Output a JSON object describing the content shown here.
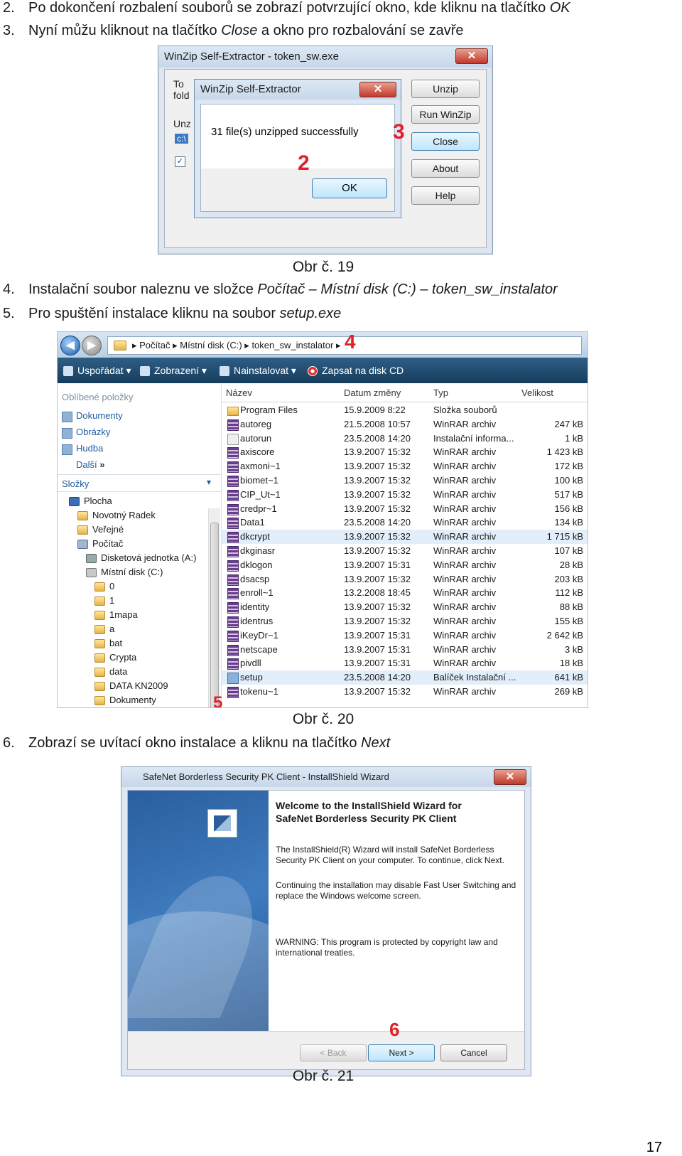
{
  "steps": [
    {
      "num": "2.",
      "pre": "Po dokončení rozbalení souborů se zobrazí potvrzující okno, kde kliknu na tlačítko ",
      "em": "OK",
      "post": ""
    },
    {
      "num": "3.",
      "pre": "Nyní můžu kliknout na tlačítko ",
      "em": "Close",
      "post": " a okno pro rozbalování se zavře"
    },
    {
      "num": "4.",
      "pre": "Instalační soubor naleznu ve složce ",
      "em": "Počítač – Místní disk (C:) – token_sw_instalator",
      "post": ""
    },
    {
      "num": "5.",
      "pre": "Pro spuštění instalace kliknu na soubor ",
      "em": "setup.exe",
      "post": ""
    },
    {
      "num": "6.",
      "pre": "Zobrazí se uvítací okno instalace a kliknu na tlačítko ",
      "em": "Next",
      "post": ""
    }
  ],
  "captions": [
    "Obr č. 19",
    "Obr č. 20",
    "Obr č. 21"
  ],
  "page_number": "17",
  "marks": [
    "2",
    "3",
    "4",
    "5",
    "6"
  ],
  "fig19": {
    "window_title": "WinZip Self-Extractor - token_sw.exe",
    "close_glyph": "✕",
    "ghost_labels": [
      "To",
      "fold",
      "Unz",
      "c:\\"
    ],
    "buttons": [
      "Unzip",
      "Run WinZip",
      "Close",
      "About",
      "Help"
    ],
    "dialog_title": "WinZip Self-Extractor",
    "dialog_message": "31 file(s) unzipped successfully",
    "ok_label": "OK"
  },
  "fig20": {
    "breadcrumb": [
      "Počítač",
      "Místní disk (C:)",
      "token_sw_instalator"
    ],
    "toolbar": [
      "Uspořádat",
      "Zobrazení",
      "Nainstalovat",
      "Zapsat na disk CD"
    ],
    "favorites_header": "Oblíbené položky",
    "favorites": [
      "Dokumenty",
      "Obrázky",
      "Hudba",
      "Další"
    ],
    "more_glyph": "»",
    "folders_header": "Složky",
    "tree": [
      "Plocha",
      "Novotný Radek",
      "Veřejné",
      "Počítač",
      "Disketová jednotka (A:)",
      "Místní disk (C:)",
      "0",
      "1",
      "1mapa",
      "a",
      "bat",
      "Crypta",
      "data",
      "DATA KN2009",
      "Dokumenty"
    ],
    "columns": [
      "Název",
      "Datum změny",
      "Typ",
      "Velikost"
    ],
    "files": [
      {
        "name": "Program Files",
        "date": "15.9.2009 8:22",
        "type": "Složka souborů",
        "size": "",
        "icon": "dir"
      },
      {
        "name": "autoreg",
        "date": "21.5.2008 10:57",
        "type": "WinRAR archiv",
        "size": "247 kB",
        "icon": "rar"
      },
      {
        "name": "autorun",
        "date": "23.5.2008 14:20",
        "type": "Instalační informa...",
        "size": "1 kB",
        "icon": "inf"
      },
      {
        "name": "axiscore",
        "date": "13.9.2007 15:32",
        "type": "WinRAR archiv",
        "size": "1 423 kB",
        "icon": "rar"
      },
      {
        "name": "axmoni~1",
        "date": "13.9.2007 15:32",
        "type": "WinRAR archiv",
        "size": "172 kB",
        "icon": "rar"
      },
      {
        "name": "biomet~1",
        "date": "13.9.2007 15:32",
        "type": "WinRAR archiv",
        "size": "100 kB",
        "icon": "rar"
      },
      {
        "name": "CIP_Ut~1",
        "date": "13.9.2007 15:32",
        "type": "WinRAR archiv",
        "size": "517 kB",
        "icon": "rar"
      },
      {
        "name": "credpr~1",
        "date": "13.9.2007 15:32",
        "type": "WinRAR archiv",
        "size": "156 kB",
        "icon": "rar"
      },
      {
        "name": "Data1",
        "date": "23.5.2008 14:20",
        "type": "WinRAR archiv",
        "size": "134 kB",
        "icon": "rar"
      },
      {
        "name": "dkcrypt",
        "date": "13.9.2007 15:32",
        "type": "WinRAR archiv",
        "size": "1 715 kB",
        "icon": "rar",
        "sel": true
      },
      {
        "name": "dkginasr",
        "date": "13.9.2007 15:32",
        "type": "WinRAR archiv",
        "size": "107 kB",
        "icon": "rar"
      },
      {
        "name": "dklogon",
        "date": "13.9.2007 15:31",
        "type": "WinRAR archiv",
        "size": "28 kB",
        "icon": "rar"
      },
      {
        "name": "dsacsp",
        "date": "13.9.2007 15:32",
        "type": "WinRAR archiv",
        "size": "203 kB",
        "icon": "rar"
      },
      {
        "name": "enroll~1",
        "date": "13.2.2008 18:45",
        "type": "WinRAR archiv",
        "size": "112 kB",
        "icon": "rar"
      },
      {
        "name": "identity",
        "date": "13.9.2007 15:32",
        "type": "WinRAR archiv",
        "size": "88 kB",
        "icon": "rar"
      },
      {
        "name": "identrus",
        "date": "13.9.2007 15:32",
        "type": "WinRAR archiv",
        "size": "155 kB",
        "icon": "rar"
      },
      {
        "name": "iKeyDr~1",
        "date": "13.9.2007 15:31",
        "type": "WinRAR archiv",
        "size": "2 642 kB",
        "icon": "rar"
      },
      {
        "name": "netscape",
        "date": "13.9.2007 15:31",
        "type": "WinRAR archiv",
        "size": "3 kB",
        "icon": "rar"
      },
      {
        "name": "pivdll",
        "date": "13.9.2007 15:31",
        "type": "WinRAR archiv",
        "size": "18 kB",
        "icon": "rar"
      },
      {
        "name": "setup",
        "date": "23.5.2008 14:20",
        "type": "Balíček Instalační ...",
        "size": "641 kB",
        "icon": "msi",
        "sel": true
      },
      {
        "name": "tokenu~1",
        "date": "13.9.2007 15:32",
        "type": "WinRAR archiv",
        "size": "269 kB",
        "icon": "rar"
      }
    ]
  },
  "fig21": {
    "window_title": "SafeNet Borderless Security PK Client - InstallShield Wizard",
    "close_glyph": "✕",
    "heading_line1": "Welcome to the InstallShield Wizard for",
    "heading_line2": "SafeNet Borderless Security PK Client",
    "p1": "The InstallShield(R) Wizard will install SafeNet Borderless Security PK Client on your computer. To continue, click Next.",
    "p2": "Continuing the installation may disable Fast User Switching and replace the Windows welcome screen.",
    "p3": "WARNING: This program is protected by copyright law and international treaties.",
    "back": "< Back",
    "next": "Next >",
    "cancel": "Cancel"
  }
}
